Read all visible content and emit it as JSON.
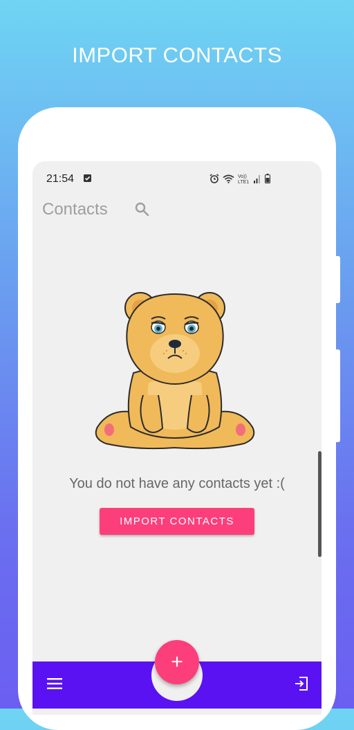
{
  "headline": "IMPORT CONTACTS",
  "status_bar": {
    "time": "21:54",
    "network_label": "Vo)) LTE1",
    "icons": [
      "check-notification-icon",
      "alarm-icon",
      "wifi-icon",
      "signal-icon",
      "battery-icon"
    ]
  },
  "app_bar": {
    "title": "Contacts",
    "search_icon": "search-icon"
  },
  "empty_state": {
    "illustration": "sad-bear",
    "message": "You do not have any contacts yet :(",
    "button_label": "IMPORT CONTACTS"
  },
  "fab": {
    "label": "+"
  },
  "bottom_bar": {
    "left_icon": "menu-icon",
    "right_icon": "logout-icon"
  },
  "colors": {
    "accent": "#fc3f7b",
    "bottom_bar": "#5a12f2",
    "screen_bg": "#f0f0f0"
  }
}
